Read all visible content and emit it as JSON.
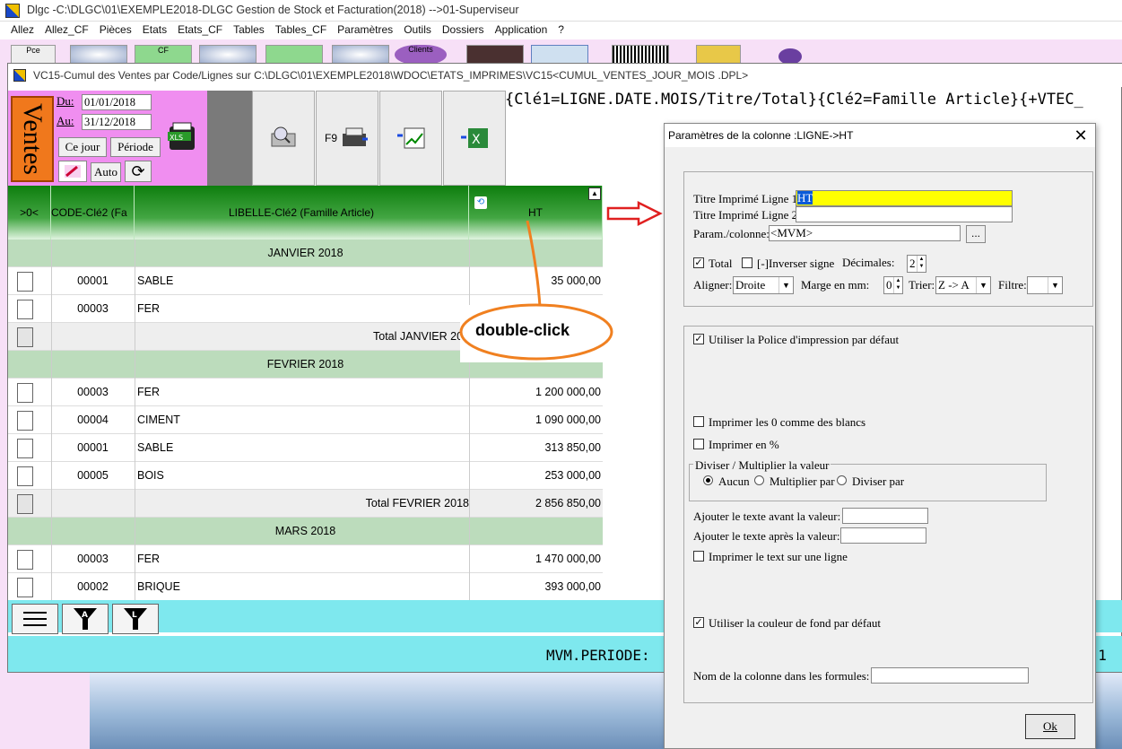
{
  "app": {
    "title": "Dlgc -C:\\DLGC\\01\\EXEMPLE2018-DLGC Gestion de Stock et Facturation(2018) -->01-Superviseur"
  },
  "menu": [
    "Allez",
    "Allez_CF",
    "Pièces",
    "Etats",
    "Etats_CF",
    "Tables",
    "Tables_CF",
    "Paramètres",
    "Outils",
    "Dossiers",
    "Application",
    "?"
  ],
  "toolbar": {
    "pce": "Pce",
    "cf": "CF",
    "clients": "Clients"
  },
  "report_window": {
    "title": "VC15-Cumul des Ventes par Code/Lignes sur C:\\DLGC\\01\\EXEMPLE2018\\WDOC\\ETATS_IMPRIMES\\VC15<CUMUL_VENTES_JOUR_MOIS .DPL>",
    "ventes_label": "Ventes",
    "du_label": "Du:",
    "au_label": "Au:",
    "du_value": "01/01/2018",
    "au_value": "31/12/2018",
    "ce_jour": "Ce jour",
    "periode": "Période",
    "auto": "Auto",
    "f9": "F9",
    "key_text": "{Clé1=LIGNE.DATE.MOIS/Titre/Total}{Clé2=Famille Article}{+VTEC_",
    "mvm_text": "MVM.PERIODE:",
    "right_num": "2 1"
  },
  "grid": {
    "headers": [
      ">0<",
      "CODE-Clé2 (Fa",
      "LIBELLE-Clé2 (Famille Article)",
      "HT"
    ],
    "rows": [
      {
        "type": "group",
        "label": "JANVIER 2018"
      },
      {
        "type": "item",
        "code": "00001",
        "lib": "SABLE",
        "ht": "35 000,00"
      },
      {
        "type": "item",
        "code": "00003",
        "lib": "FER",
        "ht": ""
      },
      {
        "type": "total",
        "label": "Total JANVIER 201",
        "ht": ""
      },
      {
        "type": "group",
        "label": "FEVRIER 2018"
      },
      {
        "type": "item",
        "code": "00003",
        "lib": "FER",
        "ht": "1 200 000,00"
      },
      {
        "type": "item",
        "code": "00004",
        "lib": "CIMENT",
        "ht": "1 090 000,00"
      },
      {
        "type": "item",
        "code": "00001",
        "lib": "SABLE",
        "ht": "313 850,00"
      },
      {
        "type": "item",
        "code": "00005",
        "lib": "BOIS",
        "ht": "253 000,00"
      },
      {
        "type": "total",
        "label": "Total FEVRIER 2018",
        "ht": "2 856 850,00"
      },
      {
        "type": "group",
        "label": "MARS 2018"
      },
      {
        "type": "item",
        "code": "00003",
        "lib": "FER",
        "ht": "1 470 000,00"
      },
      {
        "type": "item",
        "code": "00002",
        "lib": "BRIQUE",
        "ht": "393 000,00"
      }
    ]
  },
  "annotation": {
    "double_click": "double-click"
  },
  "dialog": {
    "title": "Paramètres de la colonne :LIGNE->HT",
    "titre1_label": "Titre Imprimé Ligne 1:",
    "titre1_value": "HT",
    "titre2_label": "Titre Imprimé Ligne 2:",
    "titre2_value": "",
    "param_label": "Param./colonne:",
    "param_value": "<MVM>",
    "param_btn": "...",
    "total_label": "Total",
    "inverser_label": "[-]Inverser signe",
    "decimales_label": "Décimales:",
    "decimales_value": "2",
    "aligner_label": "Aligner:",
    "aligner_value": "Droite",
    "marge_label": "Marge en mm:",
    "marge_value": "0",
    "trier_label": "Trier:",
    "trier_value": "Z -> A",
    "filtre_label": "Filtre:",
    "filtre_value": "",
    "police_label": "Utiliser la Police d'impression par défaut",
    "zero_label": "Imprimer les 0 comme des blancs",
    "pct_label": "Imprimer en %",
    "diviser_group": "Diviser / Multiplier la valeur",
    "aucun_label": "Aucun",
    "multiplier_label": "Multiplier par",
    "diviser_label": "Diviser par",
    "avant_label": "Ajouter le texte avant la valeur:",
    "apres_label": "Ajouter le texte après la valeur:",
    "une_ligne_label": "Imprimer le text sur une ligne",
    "couleur_label": "Utiliser la couleur de fond  par défaut",
    "nom_label": "Nom de la colonne dans les formules:",
    "ok": "Ok",
    "highlight_color": "#ffff00"
  }
}
